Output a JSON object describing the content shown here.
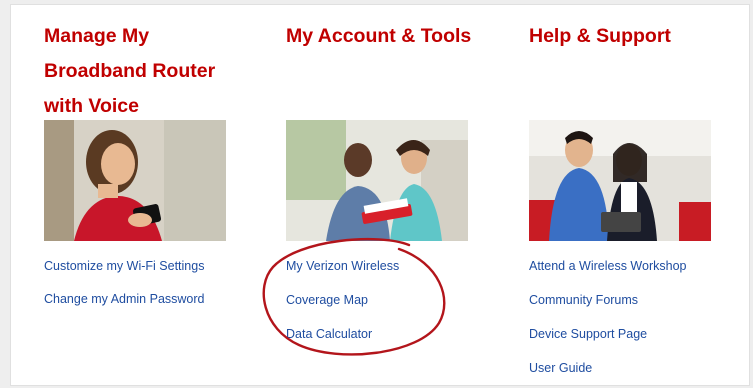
{
  "columns": [
    {
      "heading_lines": [
        "Manage My",
        "Broadband Router",
        "with Voice"
      ],
      "photo": "woman-using-smartphone",
      "links": [
        "Customize my Wi-Fi Settings",
        "Change my Admin Password"
      ]
    },
    {
      "heading_lines": [
        "My Account & Tools"
      ],
      "photo": "couple-with-tablet",
      "links": [
        "My Verizon Wireless",
        "Coverage Map",
        "Data Calculator"
      ]
    },
    {
      "heading_lines": [
        "Help & Support"
      ],
      "photo": "couple-with-device",
      "links": [
        "Attend a Wireless Workshop",
        "Community Forums",
        "Device Support Page",
        "User Guide"
      ]
    }
  ],
  "colors": {
    "heading": "#c00000",
    "link": "#1f4da0",
    "annotation_circle": "#b3151b",
    "background": "#eeeeee",
    "card": "#ffffff"
  }
}
